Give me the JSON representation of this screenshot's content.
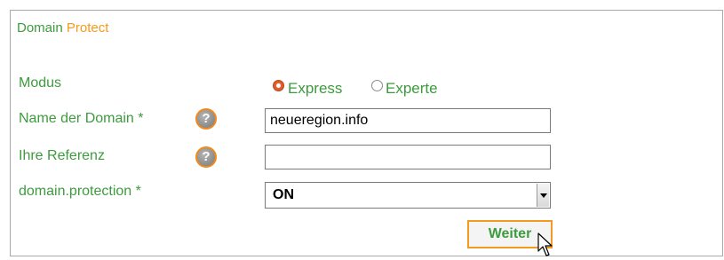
{
  "form": {
    "title_part1": "Domain",
    "title_part2": "Protect",
    "modus_label": "Modus",
    "modus_options": [
      "Express",
      "Experte"
    ],
    "modus_selected": "Express",
    "domain_label": "Name der Domain *",
    "domain_value": "neueregion.info",
    "referenz_label": "Ihre Referenz",
    "referenz_value": "",
    "protection_label": "domain.protection *",
    "protection_value": "ON",
    "help_glyph": "?",
    "submit_label": "Weiter"
  },
  "icons": [
    "help-icon",
    "cursor-icon",
    "chevron-down-icon"
  ],
  "colors": {
    "label_green": "#3e9b3e",
    "accent_orange": "#f59a1e",
    "radio_selected": "#e25b2b"
  }
}
